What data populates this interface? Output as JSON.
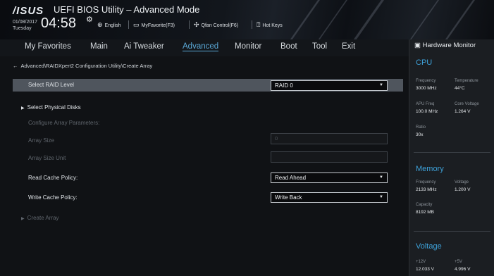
{
  "header": {
    "brand": "/ISUS",
    "title": "UEFI BIOS Utility – Advanced Mode",
    "date": "01/08/2017",
    "weekday": "Tuesday",
    "time": "04:58",
    "toolbar": [
      {
        "icon": "globe-icon",
        "label": "English"
      },
      {
        "icon": "favorites-icon",
        "label": "MyFavorite(F3)"
      },
      {
        "icon": "fan-icon",
        "label": "Qfan Control(F6)"
      },
      {
        "icon": "hotkeys-icon",
        "label": "Hot Keys"
      }
    ]
  },
  "menu": {
    "items": [
      "My Favorites",
      "Main",
      "Ai Tweaker",
      "Advanced",
      "Monitor",
      "Boot",
      "Tool",
      "Exit"
    ],
    "active": "Advanced"
  },
  "breadcrumb": "Advanced\\RAIDXpert2 Configuration Utility\\Create Array",
  "form": {
    "raid_level": {
      "label": "Select RAID Level",
      "value": "RAID 0"
    },
    "physical_disks": {
      "label": "Select Physical Disks"
    },
    "configure_header": "Configure Array Parameters:",
    "array_size": {
      "label": "Array Size",
      "value": "0"
    },
    "array_size_unit": {
      "label": "Array Size Unit",
      "value": ""
    },
    "read_cache": {
      "label": "Read Cache Policy:",
      "value": "Read Ahead"
    },
    "write_cache": {
      "label": "Write Cache Policy:",
      "value": "Write Back"
    },
    "create_array": {
      "label": "Create Array"
    }
  },
  "hardware_monitor": {
    "title": "Hardware Monitor",
    "cpu": {
      "title": "CPU",
      "frequency_label": "Frequency",
      "frequency": "3000 MHz",
      "temperature_label": "Temperature",
      "temperature": "44°C",
      "apu_freq_label": "APU Freq",
      "apu_freq": "100.0 MHz",
      "core_voltage_label": "Core Voltage",
      "core_voltage": "1.264 V",
      "ratio_label": "Ratio",
      "ratio": "30x"
    },
    "memory": {
      "title": "Memory",
      "frequency_label": "Frequency",
      "frequency": "2133 MHz",
      "voltage_label": "Voltage",
      "voltage": "1.200 V",
      "capacity_label": "Capacity",
      "capacity": "8192 MB"
    },
    "voltage": {
      "title": "Voltage",
      "v12_label": "+12V",
      "v12": "12.033 V",
      "v5_label": "+5V",
      "v5": "4.996 V"
    }
  },
  "colors": {
    "accent": "#3ea2da",
    "highlight_row": "#4f555d",
    "background": "#101215"
  }
}
